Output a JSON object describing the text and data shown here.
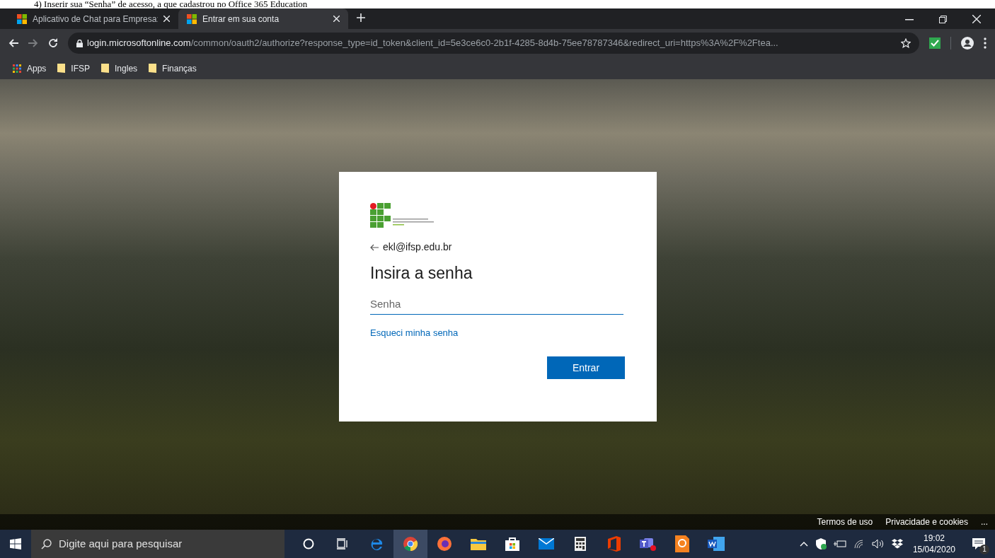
{
  "caption": "4) Inserir sua “Senha” de acesso, a que cadastrou no Office 365 Education",
  "tabs": [
    {
      "label": "Aplicativo de Chat para Empresa:",
      "selected": false
    },
    {
      "label": "Entrar em sua conta",
      "selected": true
    }
  ],
  "address": {
    "host": "login.microsoftonline.com",
    "path": "/common/oauth2/authorize?response_type=id_token&client_id=5e3ce6c0-2b1f-4285-8d4b-75ee78787346&redirect_uri=https%3A%2F%2Ftea..."
  },
  "bookmarks": [
    {
      "label": "Apps",
      "kind": "apps"
    },
    {
      "label": "IFSP",
      "kind": "folder"
    },
    {
      "label": "Ingles",
      "kind": "folder"
    },
    {
      "label": "Finanças",
      "kind": "folder"
    }
  ],
  "login": {
    "account": "ekl@ifsp.edu.br",
    "heading": "Insira a senha",
    "placeholder": "Senha",
    "forgot_link": "Esqueci minha senha",
    "submit": "Entrar"
  },
  "footer_links": [
    "Termos de uso",
    "Privacidade e cookies",
    "..."
  ],
  "taskbar": {
    "search_placeholder": "Digite aqui para pesquisar",
    "time": "19:02",
    "date": "15/04/2020",
    "notifications": "1"
  }
}
